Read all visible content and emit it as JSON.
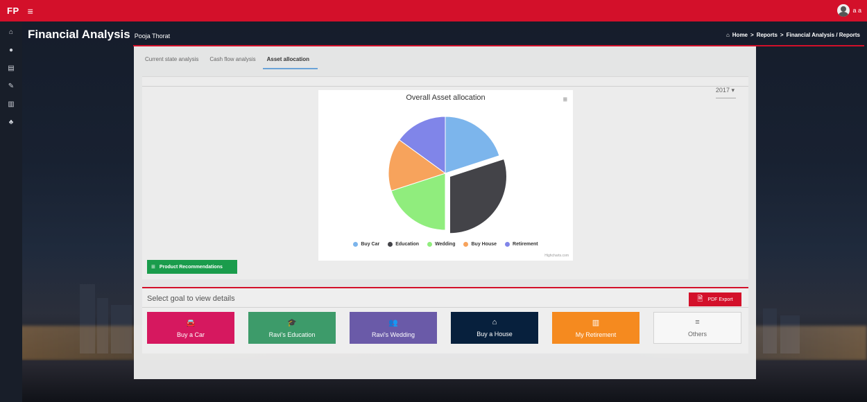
{
  "app": {
    "logo": "FP",
    "user_initials": "a a"
  },
  "sidebar": {
    "items": [
      {
        "name": "home-icon",
        "glyph": "⌂"
      },
      {
        "name": "user-icon",
        "glyph": "●"
      },
      {
        "name": "document-icon",
        "glyph": "▤"
      },
      {
        "name": "tools-icon",
        "glyph": "✎"
      },
      {
        "name": "chart-icon",
        "glyph": "▥"
      },
      {
        "name": "users-icon",
        "glyph": "♣"
      }
    ]
  },
  "header": {
    "title": "Financial Analysis",
    "subtitle": "Pooja Thorat"
  },
  "breadcrumb": {
    "home": "Home",
    "sep": ">",
    "reports": "Reports",
    "current": "Financial Analysis / Reports"
  },
  "tabs": [
    {
      "label": "Current state analysis"
    },
    {
      "label": "Cash flow analysis"
    },
    {
      "label": "Asset allocation"
    }
  ],
  "year_select": "2017",
  "chart_data": {
    "type": "pie",
    "title": "Overall Asset allocation",
    "categories": [
      "Buy Car",
      "Education",
      "Wedding",
      "Buy House",
      "Retirement"
    ],
    "values": [
      20,
      30,
      20,
      15,
      15
    ],
    "colors": [
      "#7cb5ec",
      "#434348",
      "#90ed7d",
      "#f7a35c",
      "#8085e9"
    ],
    "sliced": "Education",
    "credit": "Highcharts.com"
  },
  "product_button": "Product Recommendations",
  "goals_section": {
    "title": "Select goal to view details",
    "pdf_label": "PDF Export",
    "goals": [
      {
        "label": "Buy a Car",
        "color": "#d6185f",
        "icon": "car-icon",
        "glyph": "🚘"
      },
      {
        "label": "Ravi's Education",
        "color": "#3d9b6a",
        "icon": "graduation-cap-icon",
        "glyph": "🎓"
      },
      {
        "label": "Ravi's Wedding",
        "color": "#6a5aa8",
        "icon": "couple-icon",
        "glyph": "👥"
      },
      {
        "label": "Buy a House",
        "color": "#07203d",
        "icon": "house-icon",
        "glyph": "⌂"
      },
      {
        "label": "My Retirement",
        "color": "#f58a1f",
        "icon": "chart-icon",
        "glyph": "▥"
      },
      {
        "label": "Others",
        "color": "#f7f7f7",
        "icon": "list-icon",
        "glyph": "≡"
      }
    ]
  }
}
